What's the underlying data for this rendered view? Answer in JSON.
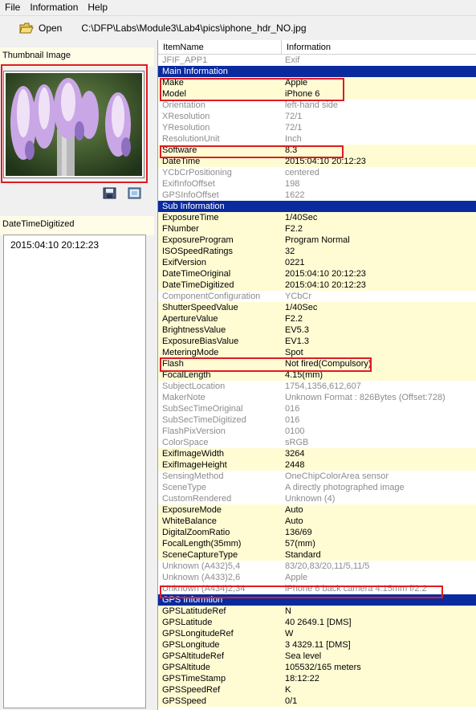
{
  "menu": [
    "File",
    "Information",
    "Help"
  ],
  "toolbar": {
    "open_label": "Open",
    "path": "C:\\DFP\\Labs\\Module3\\Lab4\\pics\\iphone_hdr_NO.jpg"
  },
  "left": {
    "thumbnail_title": "Thumbnail Image",
    "dtd_title": "DateTimeDigitized",
    "dtd_value": "2015:04:10 20:12:23"
  },
  "table": {
    "col1": "ItemName",
    "col2": "Information",
    "rows": [
      {
        "k": "g",
        "n": "JFIF_APP1",
        "v": "Exif"
      },
      {
        "k": "hdr",
        "n": "Main Information",
        "v": ""
      },
      {
        "k": "y",
        "n": "Make",
        "v": "Apple"
      },
      {
        "k": "y",
        "n": "Model",
        "v": "iPhone 6"
      },
      {
        "k": "g",
        "n": "Orientation",
        "v": "left-hand side"
      },
      {
        "k": "g",
        "n": "XResolution",
        "v": "72/1"
      },
      {
        "k": "g",
        "n": "YResolution",
        "v": "72/1"
      },
      {
        "k": "g",
        "n": "ResolutionUnit",
        "v": "Inch"
      },
      {
        "k": "y",
        "n": "Software",
        "v": "8.3"
      },
      {
        "k": "y",
        "n": "DateTime",
        "v": "2015:04:10 20:12:23"
      },
      {
        "k": "g",
        "n": "YCbCrPositioning",
        "v": "centered"
      },
      {
        "k": "g",
        "n": "ExifInfoOffset",
        "v": "198"
      },
      {
        "k": "g",
        "n": "GPSInfoOffset",
        "v": "1622"
      },
      {
        "k": "hdr",
        "n": "Sub Information",
        "v": ""
      },
      {
        "k": "y",
        "n": "ExposureTime",
        "v": "1/40Sec"
      },
      {
        "k": "y",
        "n": "FNumber",
        "v": "F2.2"
      },
      {
        "k": "y",
        "n": "ExposureProgram",
        "v": "Program Normal"
      },
      {
        "k": "y",
        "n": "ISOSpeedRatings",
        "v": "32"
      },
      {
        "k": "y",
        "n": "ExifVersion",
        "v": "0221"
      },
      {
        "k": "y",
        "n": "DateTimeOriginal",
        "v": "2015:04:10 20:12:23"
      },
      {
        "k": "y",
        "n": "DateTimeDigitized",
        "v": "2015:04:10 20:12:23"
      },
      {
        "k": "g",
        "n": "ComponentConfiguration",
        "v": "YCbCr"
      },
      {
        "k": "y",
        "n": "ShutterSpeedValue",
        "v": "1/40Sec"
      },
      {
        "k": "y",
        "n": "ApertureValue",
        "v": "F2.2"
      },
      {
        "k": "y",
        "n": "BrightnessValue",
        "v": "EV5.3"
      },
      {
        "k": "y",
        "n": "ExposureBiasValue",
        "v": "EV1.3"
      },
      {
        "k": "y",
        "n": "MeteringMode",
        "v": "Spot"
      },
      {
        "k": "y",
        "n": "Flash",
        "v": "Not fired(Compulsory)"
      },
      {
        "k": "y",
        "n": "FocalLength",
        "v": "4.15(mm)"
      },
      {
        "k": "g",
        "n": "SubjectLocation",
        "v": "1754,1356,612,607"
      },
      {
        "k": "g",
        "n": "MakerNote",
        "v": "Unknown Format : 826Bytes (Offset:728)"
      },
      {
        "k": "g",
        "n": "SubSecTimeOriginal",
        "v": "016"
      },
      {
        "k": "g",
        "n": "SubSecTimeDigitized",
        "v": "016"
      },
      {
        "k": "g",
        "n": "FlashPixVersion",
        "v": "0100"
      },
      {
        "k": "g",
        "n": "ColorSpace",
        "v": "sRGB"
      },
      {
        "k": "y",
        "n": "ExifImageWidth",
        "v": "3264"
      },
      {
        "k": "y",
        "n": "ExifImageHeight",
        "v": "2448"
      },
      {
        "k": "g",
        "n": "SensingMethod",
        "v": "OneChipColorArea sensor"
      },
      {
        "k": "g",
        "n": "SceneType",
        "v": "A directly photographed image"
      },
      {
        "k": "g",
        "n": "CustomRendered",
        "v": "Unknown (4)"
      },
      {
        "k": "y",
        "n": "ExposureMode",
        "v": "Auto"
      },
      {
        "k": "y",
        "n": "WhiteBalance",
        "v": "Auto"
      },
      {
        "k": "y",
        "n": "DigitalZoomRatio",
        "v": "136/69"
      },
      {
        "k": "y",
        "n": "FocalLength(35mm)",
        "v": "57(mm)"
      },
      {
        "k": "y",
        "n": "SceneCaptureType",
        "v": "Standard"
      },
      {
        "k": "g",
        "n": "Unknown (A432)5,4",
        "v": "83/20,83/20,11/5,11/5"
      },
      {
        "k": "g",
        "n": "Unknown (A433)2,6",
        "v": "Apple"
      },
      {
        "k": "g",
        "n": "Unknown (A434)2,34",
        "v": "iPhone 6 back camera 4.15mm f/2.2"
      },
      {
        "k": "hdr",
        "n": "GPS Informtion",
        "v": ""
      },
      {
        "k": "y",
        "n": "GPSLatitudeRef",
        "v": "N"
      },
      {
        "k": "y",
        "n": "GPSLatitude",
        "v": "40 2649.1 [DMS]"
      },
      {
        "k": "y",
        "n": "GPSLongitudeRef",
        "v": "W"
      },
      {
        "k": "y",
        "n": "GPSLongitude",
        "v": "3 4329.11 [DMS]"
      },
      {
        "k": "y",
        "n": "GPSAltitudeRef",
        "v": "Sea level"
      },
      {
        "k": "y",
        "n": "GPSAltitude",
        "v": "105532/165 meters"
      },
      {
        "k": "y",
        "n": "GPSTimeStamp",
        "v": "18:12:22"
      },
      {
        "k": "y",
        "n": "GPSSpeedRef",
        "v": "K"
      },
      {
        "k": "y",
        "n": "GPSSpeed",
        "v": "0/1"
      }
    ]
  }
}
